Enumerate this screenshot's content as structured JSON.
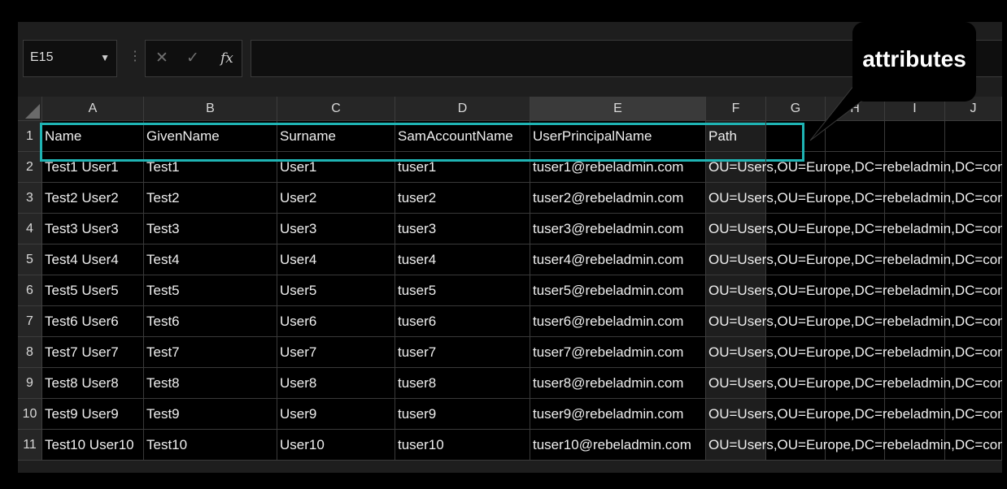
{
  "formula_bar": {
    "name_box": "E15",
    "cancel_icon": "x-icon",
    "enter_icon": "check-icon",
    "fx_label": "fx",
    "formula": ""
  },
  "columns": [
    "A",
    "B",
    "C",
    "D",
    "E",
    "F",
    "G",
    "H",
    "I",
    "J"
  ],
  "selected_column": "E",
  "rows": [
    {
      "num": "1",
      "cells": [
        "Name",
        "GivenName",
        "Surname",
        "SamAccountName",
        "UserPrincipalName",
        "Path"
      ]
    },
    {
      "num": "2",
      "cells": [
        "Test1 User1",
        "Test1",
        "User1",
        "tuser1",
        "tuser1@rebeladmin.com",
        "OU=Users,OU=Europe,DC=rebeladmin,DC=com"
      ]
    },
    {
      "num": "3",
      "cells": [
        "Test2 User2",
        "Test2",
        "User2",
        "tuser2",
        "tuser2@rebeladmin.com",
        "OU=Users,OU=Europe,DC=rebeladmin,DC=com"
      ]
    },
    {
      "num": "4",
      "cells": [
        "Test3 User3",
        "Test3",
        "User3",
        "tuser3",
        "tuser3@rebeladmin.com",
        "OU=Users,OU=Europe,DC=rebeladmin,DC=com"
      ]
    },
    {
      "num": "5",
      "cells": [
        "Test4 User4",
        "Test4",
        "User4",
        "tuser4",
        "tuser4@rebeladmin.com",
        "OU=Users,OU=Europe,DC=rebeladmin,DC=com"
      ]
    },
    {
      "num": "6",
      "cells": [
        "Test5 User5",
        "Test5",
        "User5",
        "tuser5",
        "tuser5@rebeladmin.com",
        "OU=Users,OU=Europe,DC=rebeladmin,DC=com"
      ]
    },
    {
      "num": "7",
      "cells": [
        "Test6 User6",
        "Test6",
        "User6",
        "tuser6",
        "tuser6@rebeladmin.com",
        "OU=Users,OU=Europe,DC=rebeladmin,DC=com"
      ]
    },
    {
      "num": "8",
      "cells": [
        "Test7 User7",
        "Test7",
        "User7",
        "tuser7",
        "tuser7@rebeladmin.com",
        "OU=Users,OU=Europe,DC=rebeladmin,DC=com"
      ]
    },
    {
      "num": "9",
      "cells": [
        "Test8 User8",
        "Test8",
        "User8",
        "tuser8",
        "tuser8@rebeladmin.com",
        "OU=Users,OU=Europe,DC=rebeladmin,DC=com"
      ]
    },
    {
      "num": "10",
      "cells": [
        "Test9 User9",
        "Test9",
        "User9",
        "tuser9",
        "tuser9@rebeladmin.com",
        "OU=Users,OU=Europe,DC=rebeladmin,DC=com"
      ]
    },
    {
      "num": "11",
      "cells": [
        "Test10 User10",
        "Test10",
        "User10",
        "tuser10",
        "tuser10@rebeladmin.com",
        "OU=Users,OU=Europe,DC=rebeladmin,DC=com"
      ]
    }
  ],
  "callout": {
    "label": "attributes"
  },
  "colors": {
    "highlight": "#1fb4b4",
    "background": "#000000"
  }
}
